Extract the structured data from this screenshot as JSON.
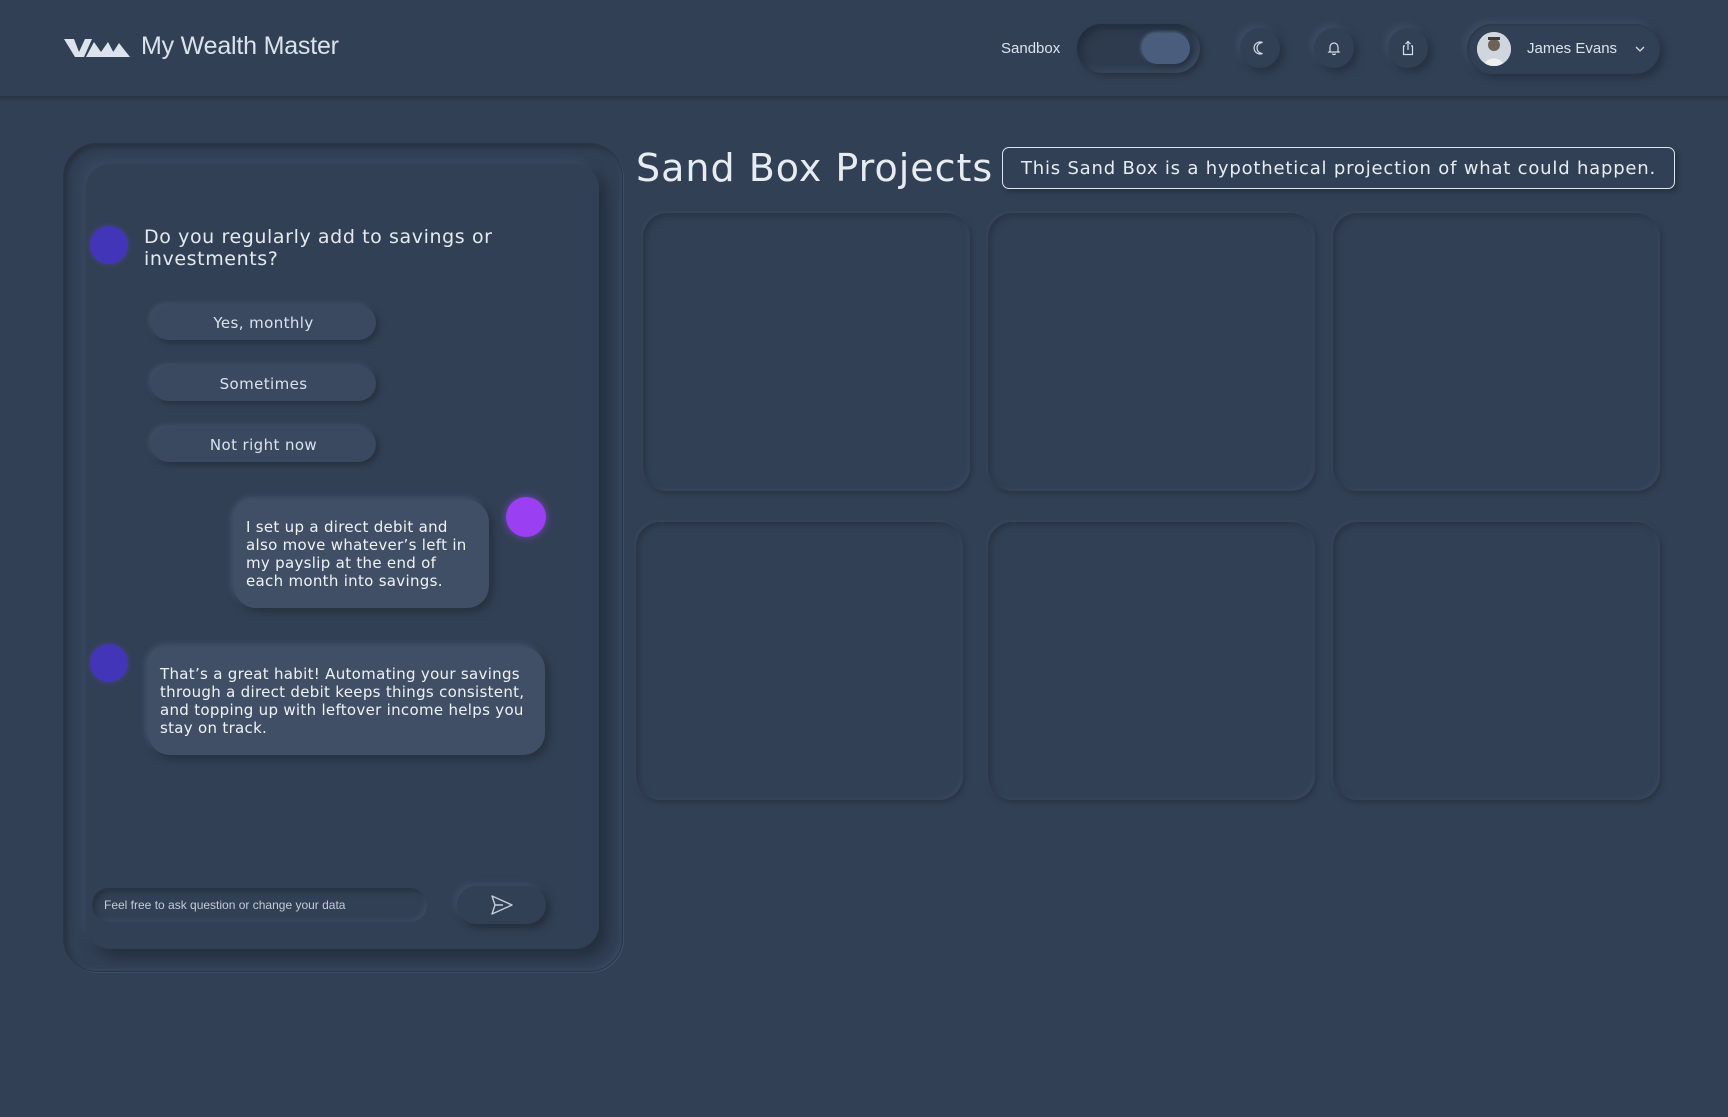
{
  "header": {
    "brand": "My Wealth Master",
    "sandbox_label": "Sandbox",
    "sandbox_on": true,
    "icons": [
      "moon-icon",
      "bell-icon",
      "share-icon"
    ],
    "user_name": "James Evans"
  },
  "chat": {
    "question": "Do you regularly add to savings or investments?",
    "options": [
      "Yes, monthly",
      "Sometimes",
      "Not right now"
    ],
    "user_message": "I set up a direct debit and also move whatever’s left in my payslip at the end of each month into savings.",
    "bot_message": "That’s a great habit! Automating your savings through a direct debit keeps things consistent, and topping up with leftover income helps you stay on track.",
    "input_placeholder": "Feel free to ask question or change your data"
  },
  "projects": {
    "title": "Sand Box Projects",
    "notice": "This Sand Box is a hypothetical projection of what could happen.",
    "card_count": 6
  },
  "colors": {
    "background": "#324055",
    "bot_avatar": "#4335b8",
    "user_avatar": "#9b3ff2",
    "toggle_knob": "#4a5d7c"
  }
}
